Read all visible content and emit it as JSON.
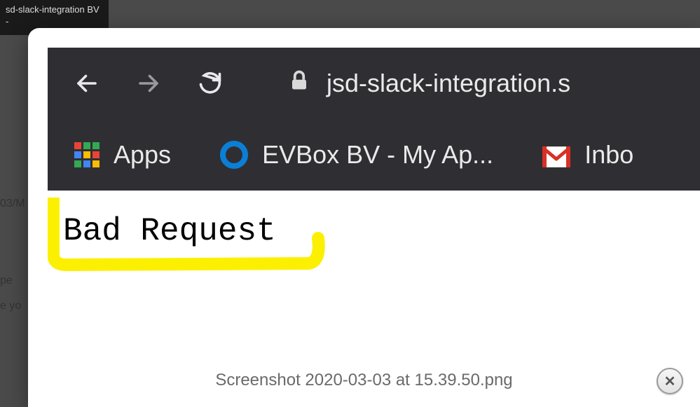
{
  "thumbnail": {
    "label": "sd-slack-integration\nBV -"
  },
  "background": {
    "text1": "03/M",
    "text2": "pe",
    "text3": "e yo"
  },
  "browser": {
    "url_display": "jsd-slack-integration.s",
    "bookmarks": {
      "apps_label": "Apps",
      "item1_label": "EVBox BV - My Ap...",
      "item2_label": "Inbo"
    }
  },
  "page": {
    "body_text": "Bad Request"
  },
  "lightbox": {
    "caption": "Screenshot 2020-03-03 at 15.39.50.png",
    "close_glyph": "✕"
  }
}
